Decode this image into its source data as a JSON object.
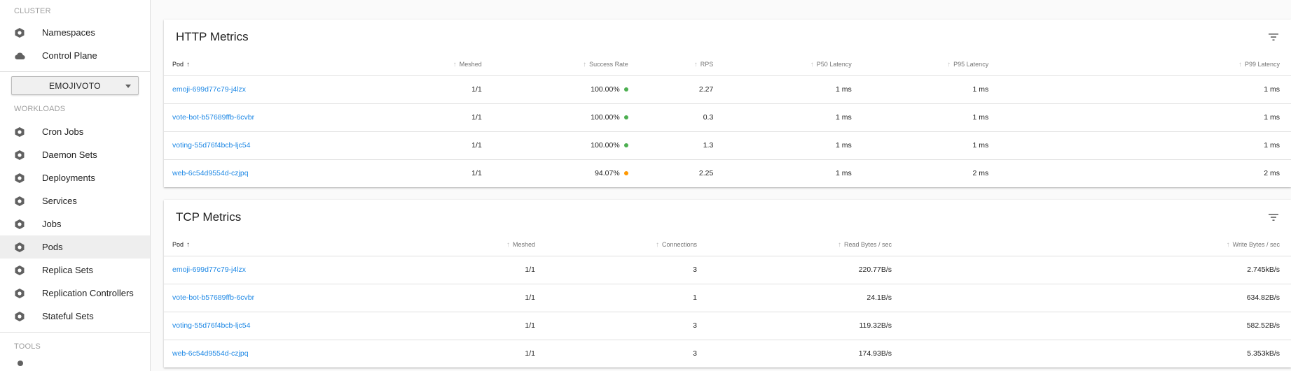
{
  "sidebar": {
    "cluster_header": "CLUSTER",
    "cluster_items": [
      {
        "label": "Namespaces",
        "icon": "namespaces-icon"
      },
      {
        "label": "Control Plane",
        "icon": "cloud-icon"
      }
    ],
    "namespace_select": "EMOJIVOTO",
    "workloads_header": "WORKLOADS",
    "workload_items": [
      {
        "label": "Cron Jobs",
        "icon": "cron-jobs-icon"
      },
      {
        "label": "Daemon Sets",
        "icon": "daemon-sets-icon"
      },
      {
        "label": "Deployments",
        "icon": "deployments-icon"
      },
      {
        "label": "Services",
        "icon": "services-icon"
      },
      {
        "label": "Jobs",
        "icon": "jobs-icon"
      },
      {
        "label": "Pods",
        "icon": "pods-icon",
        "active": true
      },
      {
        "label": "Replica Sets",
        "icon": "replica-sets-icon"
      },
      {
        "label": "Replication Controllers",
        "icon": "replication-controllers-icon"
      },
      {
        "label": "Stateful Sets",
        "icon": "stateful-sets-icon"
      }
    ],
    "tools_header": "TOOLS"
  },
  "http": {
    "title": "HTTP Metrics",
    "columns": [
      "Pod",
      "Meshed",
      "Success Rate",
      "RPS",
      "P50 Latency",
      "P95 Latency",
      "P99 Latency"
    ],
    "rows": [
      {
        "pod": "emoji-699d77c79-j4lzx",
        "meshed": "1/1",
        "success": "100.00%",
        "status": "green",
        "rps": "2.27",
        "p50": "1 ms",
        "p95": "1 ms",
        "p99": "1 ms"
      },
      {
        "pod": "vote-bot-b57689ffb-6cvbr",
        "meshed": "1/1",
        "success": "100.00%",
        "status": "green",
        "rps": "0.3",
        "p50": "1 ms",
        "p95": "1 ms",
        "p99": "1 ms"
      },
      {
        "pod": "voting-55d76f4bcb-ljc54",
        "meshed": "1/1",
        "success": "100.00%",
        "status": "green",
        "rps": "1.3",
        "p50": "1 ms",
        "p95": "1 ms",
        "p99": "1 ms"
      },
      {
        "pod": "web-6c54d9554d-czjpq",
        "meshed": "1/1",
        "success": "94.07%",
        "status": "orange",
        "rps": "2.25",
        "p50": "1 ms",
        "p95": "2 ms",
        "p99": "2 ms"
      }
    ]
  },
  "tcp": {
    "title": "TCP Metrics",
    "columns": [
      "Pod",
      "Meshed",
      "Connections",
      "Read Bytes / sec",
      "Write Bytes / sec"
    ],
    "rows": [
      {
        "pod": "emoji-699d77c79-j4lzx",
        "meshed": "1/1",
        "connections": "3",
        "read": "220.77B/s",
        "write": "2.745kB/s"
      },
      {
        "pod": "vote-bot-b57689ffb-6cvbr",
        "meshed": "1/1",
        "connections": "1",
        "read": "24.1B/s",
        "write": "634.82B/s"
      },
      {
        "pod": "voting-55d76f4bcb-ljc54",
        "meshed": "1/1",
        "connections": "3",
        "read": "119.32B/s",
        "write": "582.52B/s"
      },
      {
        "pod": "web-6c54d9554d-czjpq",
        "meshed": "1/1",
        "connections": "3",
        "read": "174.93B/s",
        "write": "5.353kB/s"
      }
    ]
  },
  "colors": {
    "link": "#1e88e5",
    "green": "#4caf50",
    "orange": "#ff9800"
  }
}
